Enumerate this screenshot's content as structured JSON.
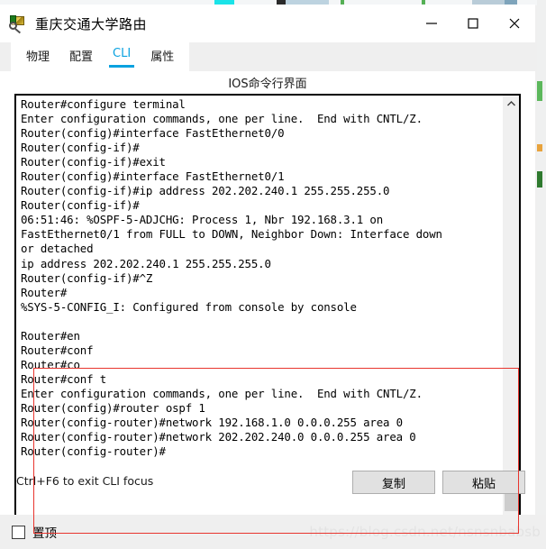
{
  "window": {
    "title": "重庆交通大学路由",
    "icon": "router-package-magnifier-icon",
    "controls": {
      "minimize": "minimize-icon",
      "maximize": "maximize-icon",
      "close": "close-icon"
    }
  },
  "tabs": [
    {
      "label": "物理",
      "active": false
    },
    {
      "label": "配置",
      "active": false
    },
    {
      "label": "CLI",
      "active": true
    },
    {
      "label": "属性",
      "active": false
    }
  ],
  "panel": {
    "heading": "IOS命令行界面",
    "hint": "Ctrl+F6 to exit CLI focus",
    "copy_label": "复制",
    "paste_label": "粘贴"
  },
  "terminal": {
    "lines": [
      "Router#configure terminal",
      "Enter configuration commands, one per line.  End with CNTL/Z.",
      "Router(config)#interface FastEthernet0/0",
      "Router(config-if)#",
      "Router(config-if)#exit",
      "Router(config)#interface FastEthernet0/1",
      "Router(config-if)#ip address 202.202.240.1 255.255.255.0",
      "Router(config-if)#",
      "06:51:46: %OSPF-5-ADJCHG: Process 1, Nbr 192.168.3.1 on",
      "FastEthernet0/1 from FULL to DOWN, Neighbor Down: Interface down",
      "or detached",
      "ip address 202.202.240.1 255.255.255.0",
      "Router(config-if)#^Z",
      "Router#",
      "%SYS-5-CONFIG_I: Configured from console by console",
      "",
      "Router#en",
      "Router#conf",
      "Router#co",
      "Router#conf t",
      "Enter configuration commands, one per line.  End with CNTL/Z.",
      "Router(config)#router ospf 1",
      "Router(config-router)#network 192.168.1.0 0.0.0.255 area 0",
      "Router(config-router)#network 202.202.240.0 0.0.0.255 area 0",
      "Router(config-router)#"
    ]
  },
  "scrollbar": {
    "up_arrow": "chevron-up-icon",
    "down_arrow": "chevron-down-icon"
  },
  "bottom": {
    "pin_label": "置顶",
    "pin_checked": false,
    "watermark": "https://blog.csdn.net/nsnsnbabsb"
  },
  "colors": {
    "accent": "#0aa2e0",
    "annotation": "#e8352e",
    "window_bg": "#ffffff",
    "chrome_bg": "#efefef",
    "button_bg": "#e1e1e1"
  }
}
